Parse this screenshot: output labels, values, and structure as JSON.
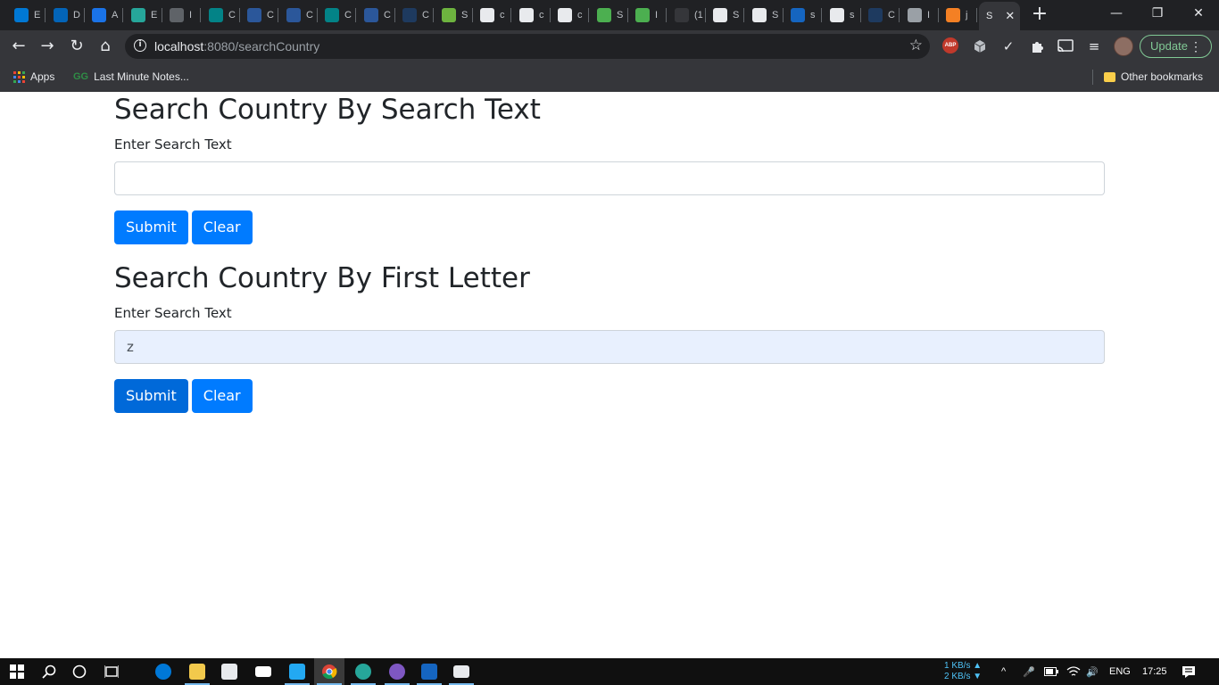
{
  "browser": {
    "tabs": [
      {
        "title": "E",
        "color": "#0078d4"
      },
      {
        "title": "D",
        "color": "#0364b8"
      },
      {
        "title": "A",
        "color": "#1a73e8"
      },
      {
        "title": "E",
        "color": "#26a69a"
      },
      {
        "title": "I",
        "color": "#5f6368"
      },
      {
        "title": "C",
        "color": "#038387"
      },
      {
        "title": "C",
        "color": "#2b579a"
      },
      {
        "title": "C",
        "color": "#2b579a"
      },
      {
        "title": "C",
        "color": "#038387"
      },
      {
        "title": "C",
        "color": "#2b579a"
      },
      {
        "title": "C",
        "color": "#1e3a5f"
      },
      {
        "title": "S",
        "color": "#6db33f"
      },
      {
        "title": "c",
        "color": "#e8eaed"
      },
      {
        "title": "c",
        "color": "#e8eaed"
      },
      {
        "title": "c",
        "color": "#e8eaed"
      },
      {
        "title": "S",
        "color": "#4caf50"
      },
      {
        "title": "I",
        "color": "#4caf50"
      },
      {
        "title": "(1",
        "color": "#35363a"
      },
      {
        "title": "S",
        "color": "#e8eaed"
      },
      {
        "title": "S",
        "color": "#e8eaed"
      },
      {
        "title": "s",
        "color": "#1565c0"
      },
      {
        "title": "s",
        "color": "#e8eaed"
      },
      {
        "title": "C",
        "color": "#1e3a5f"
      },
      {
        "title": "I",
        "color": "#9aa0a6"
      },
      {
        "title": "j",
        "color": "#f48024"
      }
    ],
    "active_tab": {
      "title": "S",
      "close": "✕"
    },
    "new_tab": "+",
    "window_controls": {
      "minimize": "—",
      "restore": "❐",
      "close": "✕"
    },
    "nav": {
      "back": "←",
      "forward": "→",
      "reload": "↻",
      "home": "⌂"
    },
    "url": {
      "host": "localhost",
      "path": ":8080/searchCountry"
    },
    "update_label": "Update",
    "bookmarks": {
      "apps": "Apps",
      "last_minute": "Last Minute Notes...",
      "other": "Other bookmarks"
    }
  },
  "page": {
    "section1": {
      "title": "Search Country By Search Text",
      "label": "Enter Search Text",
      "value": "",
      "submit": "Submit",
      "clear": "Clear"
    },
    "section2": {
      "title": "Search Country By First Letter",
      "label": "Enter Search Text",
      "value": "z",
      "submit": "Submit",
      "clear": "Clear"
    }
  },
  "taskbar": {
    "net_up": "1 KB/s ▲",
    "net_down": "2 KB/s ▼",
    "lang": "ENG",
    "time": "17:25"
  },
  "colors": {
    "primary_button": "#007bff",
    "autofill_bg": "#e8f0fe"
  }
}
